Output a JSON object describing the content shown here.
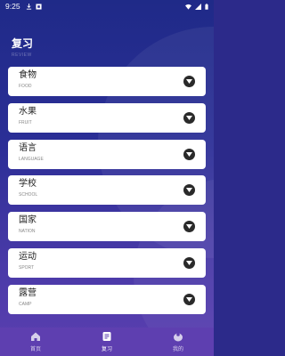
{
  "status_bar": {
    "time": "9:25"
  },
  "header": {
    "title": "复习",
    "subtitle": "REVIEW"
  },
  "categories": [
    {
      "label": "食物",
      "en": "FOOD"
    },
    {
      "label": "水果",
      "en": "FRUIT"
    },
    {
      "label": "语言",
      "en": "LANGUAGE"
    },
    {
      "label": "学校",
      "en": "SCHOOL"
    },
    {
      "label": "国家",
      "en": "NATION"
    },
    {
      "label": "运动",
      "en": "SPORT"
    },
    {
      "label": "露营",
      "en": "CAMP"
    }
  ],
  "tabbar": {
    "tabs": [
      {
        "label": "首页",
        "icon": "home-icon",
        "active": false
      },
      {
        "label": "复习",
        "icon": "review-icon",
        "active": true
      },
      {
        "label": "我的",
        "icon": "profile-icon",
        "active": false
      }
    ]
  },
  "colors": {
    "card_bg": "#ffffff",
    "tabbar_bg": "#5e3fb0",
    "bg_top": "#1f2a88"
  }
}
